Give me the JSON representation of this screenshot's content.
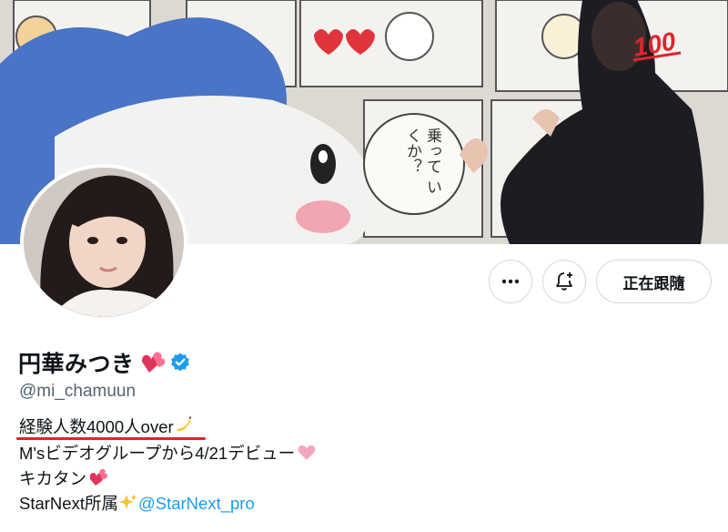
{
  "profile": {
    "display_name": "円華みつき",
    "handle": "@mi_chamuun",
    "follow_label": "正在跟隨"
  },
  "bio": {
    "line1": "経験人数4000人over",
    "line2": "M'sビデオグループから4/21デビュー",
    "line3": "キカタン",
    "line4_text": "StarNext所属",
    "line4_link": "@StarNext_pro"
  },
  "banner": {
    "speech_bubble": "乗って いくか？",
    "sticker": "100"
  },
  "colors": {
    "link": "#1d9bf0",
    "underline": "#e2232a",
    "verified": "#1d9bf0",
    "border": "#cfd9de"
  },
  "icons": [
    "verified-badge-icon",
    "more-icon",
    "notification-add-icon",
    "heart-emoji-icon",
    "banana-emoji-icon",
    "sparkles-emoji-icon"
  ]
}
